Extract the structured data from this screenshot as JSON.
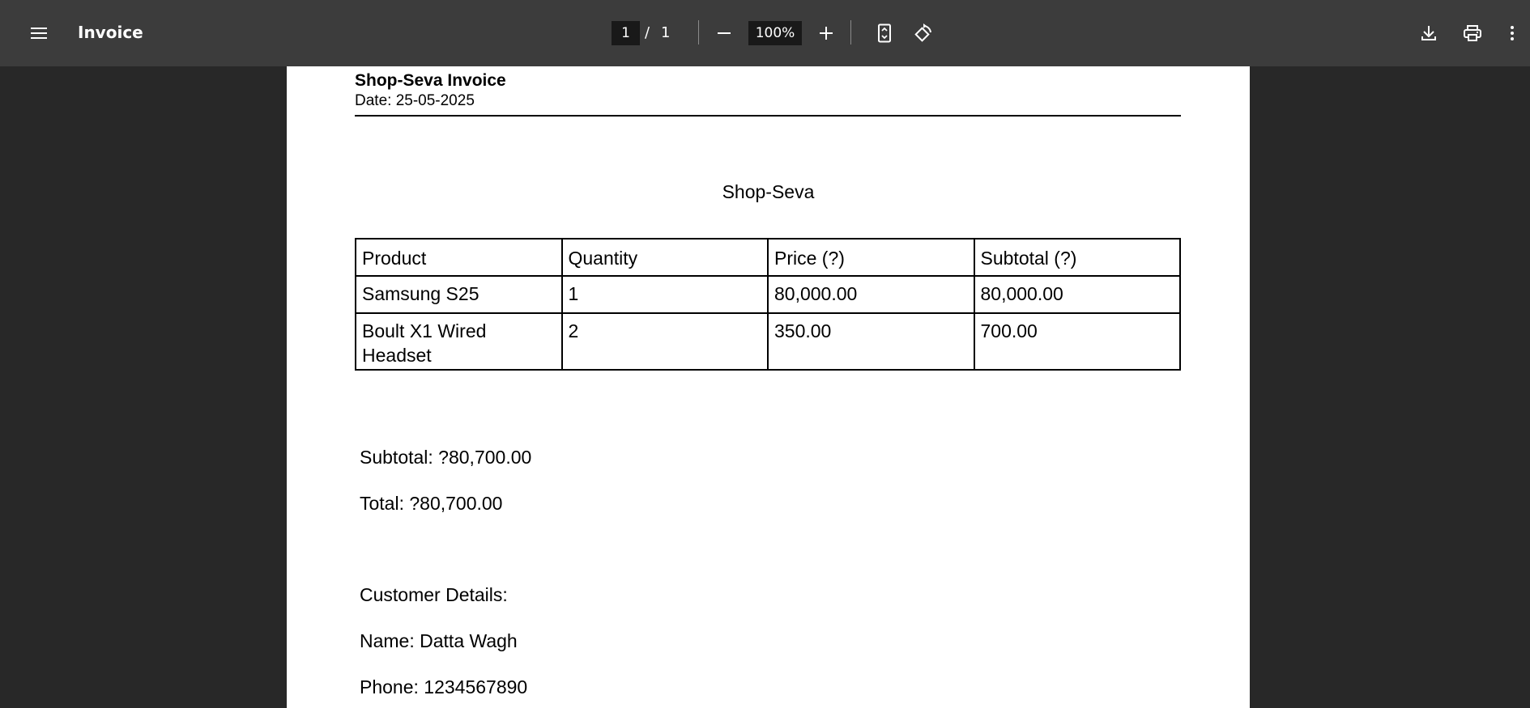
{
  "toolbar": {
    "title": "Invoice",
    "page_current": "1",
    "page_separator": "/",
    "page_total": "1",
    "zoom": "100%"
  },
  "document": {
    "header_title": "Shop-Seva Invoice",
    "date": "Date: 25-05-2025",
    "shop_name": "Shop-Seva",
    "table": {
      "headers": [
        "Product",
        "Quantity",
        "Price (?)",
        "Subtotal (?)"
      ],
      "rows": [
        [
          "Samsung S25",
          "1",
          "80,000.00",
          "80,000.00"
        ],
        [
          "Boult X1 Wired Headset",
          "2",
          "350.00",
          "700.00"
        ]
      ]
    },
    "subtotal": "Subtotal: ?80,700.00",
    "total": "Total: ?80,700.00",
    "customer_heading": "Customer Details:",
    "customer_name": "Name: Datta Wagh",
    "customer_phone": "Phone: 1234567890"
  },
  "colors": {
    "toolbar_bg": "#3c3c3c",
    "viewer_bg": "#282828",
    "page_bg": "#ffffff"
  },
  "icons": [
    "menu-icon",
    "minus-icon",
    "plus-icon",
    "fit-to-page-icon",
    "rotate-icon",
    "download-icon",
    "print-icon",
    "more-vert-icon"
  ]
}
